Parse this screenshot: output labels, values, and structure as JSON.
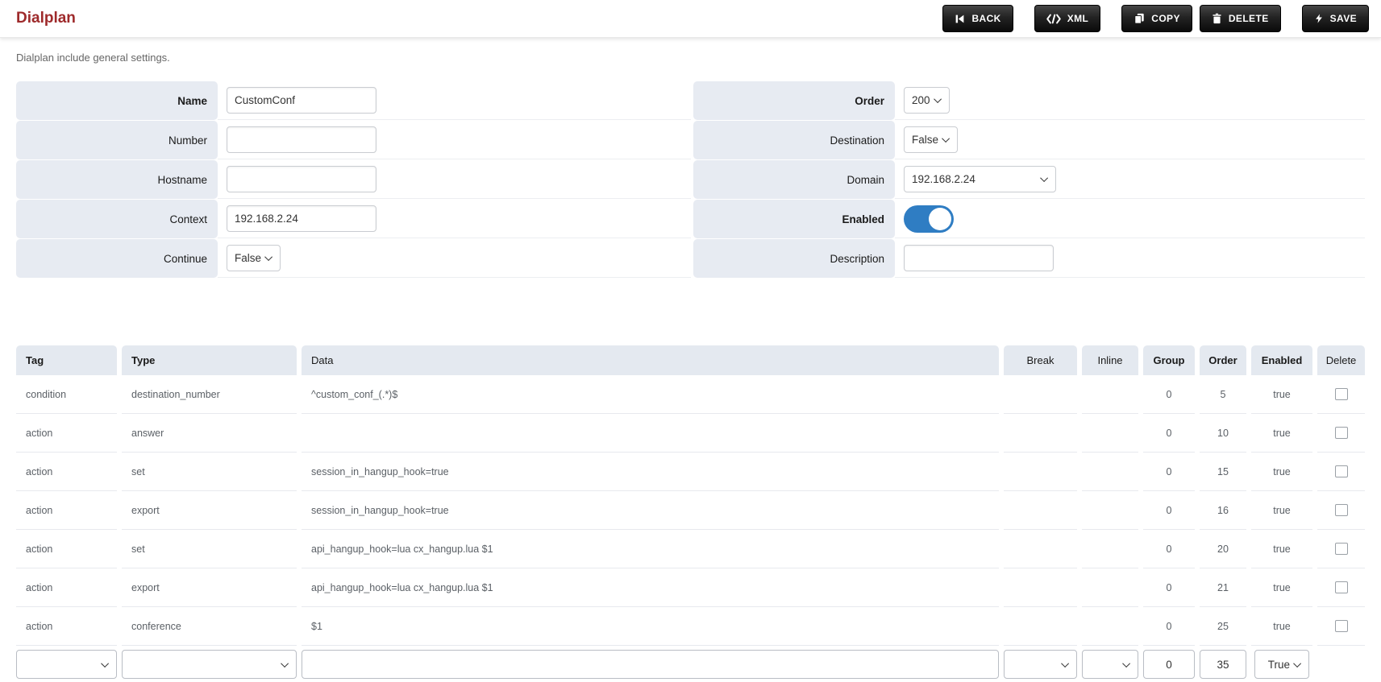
{
  "header": {
    "title": "Dialplan",
    "buttons": [
      {
        "label": "BACK",
        "icon": "skip-back-icon"
      },
      {
        "label": "XML",
        "icon": "code-icon"
      },
      {
        "label": "COPY",
        "icon": "copy-icon"
      },
      {
        "label": "DELETE",
        "icon": "trash-icon"
      },
      {
        "label": "SAVE",
        "icon": "lightning-icon"
      }
    ]
  },
  "subtitle": "Dialplan include general settings.",
  "form": {
    "left": [
      {
        "label": "Name",
        "value": "CustomConf"
      },
      {
        "label": "Number",
        "value": ""
      },
      {
        "label": "Hostname",
        "value": ""
      },
      {
        "label": "Context",
        "value": "192.168.2.24"
      },
      {
        "label": "Continue",
        "value": "False"
      }
    ],
    "right": [
      {
        "label": "Order",
        "value": "200"
      },
      {
        "label": "Destination",
        "value": "False"
      },
      {
        "label": "Domain",
        "value": "192.168.2.24"
      },
      {
        "label": "Enabled",
        "value": "on"
      },
      {
        "label": "Description",
        "value": ""
      }
    ]
  },
  "table": {
    "columns": [
      {
        "label": "Tag"
      },
      {
        "label": "Type"
      },
      {
        "label": "Data"
      },
      {
        "label": "Break"
      },
      {
        "label": "Inline"
      },
      {
        "label": "Group"
      },
      {
        "label": "Order"
      },
      {
        "label": "Enabled"
      },
      {
        "label": "Delete"
      }
    ],
    "rows": [
      {
        "tag": "condition",
        "type": "destination_number",
        "data": "^custom_conf_(.*)$",
        "break": "",
        "inline": "",
        "group": "0",
        "order": "5",
        "enabled": "true"
      },
      {
        "tag": "action",
        "type": "answer",
        "data": "",
        "break": "",
        "inline": "",
        "group": "0",
        "order": "10",
        "enabled": "true"
      },
      {
        "tag": "action",
        "type": "set",
        "data": "session_in_hangup_hook=true",
        "break": "",
        "inline": "",
        "group": "0",
        "order": "15",
        "enabled": "true"
      },
      {
        "tag": "action",
        "type": "export",
        "data": "session_in_hangup_hook=true",
        "break": "",
        "inline": "",
        "group": "0",
        "order": "16",
        "enabled": "true"
      },
      {
        "tag": "action",
        "type": "set",
        "data": "api_hangup_hook=lua cx_hangup.lua $1",
        "break": "",
        "inline": "",
        "group": "0",
        "order": "20",
        "enabled": "true"
      },
      {
        "tag": "action",
        "type": "export",
        "data": "api_hangup_hook=lua cx_hangup.lua $1",
        "break": "",
        "inline": "",
        "group": "0",
        "order": "21",
        "enabled": "true"
      },
      {
        "tag": "action",
        "type": "conference",
        "data": "$1",
        "break": "",
        "inline": "",
        "group": "0",
        "order": "25",
        "enabled": "true"
      }
    ],
    "new_row": {
      "tag": "",
      "type": "",
      "data": "",
      "break": "",
      "inline": "",
      "group": "0",
      "order": "35",
      "enabled": "True"
    }
  },
  "colors": {
    "title": "#9e2a2b",
    "label_bg": "#e7ebf2",
    "header_cell_bg": "#e4e9f0",
    "toggle_on": "#2f7dc3",
    "button_bg": "#1a1a1a"
  }
}
